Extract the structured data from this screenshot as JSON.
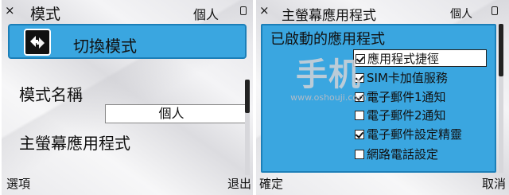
{
  "left": {
    "title": "模式",
    "profile": "個人",
    "close_glyph": "×",
    "switch_label": "切換模式",
    "mode_name_label": "模式名稱",
    "mode_name_value": "個人",
    "home_screen_label": "主螢幕應用程式",
    "softkey_left": "選項",
    "softkey_right": "退出"
  },
  "right": {
    "title": "主螢幕應用程式",
    "profile": "個人",
    "close_glyph": "×",
    "panel_title": "已啟動的應用程式",
    "options": [
      {
        "label": "應用程式捷徑",
        "checked": true,
        "selected": true
      },
      {
        "label": "SIM卡加值服務",
        "checked": true,
        "selected": false
      },
      {
        "label": "電子郵件1通知",
        "checked": true,
        "selected": false
      },
      {
        "label": "電子郵件2通知",
        "checked": false,
        "selected": false
      },
      {
        "label": "電子郵件設定精靈",
        "checked": true,
        "selected": false
      },
      {
        "label": "網路電話設定",
        "checked": false,
        "selected": false
      }
    ],
    "softkey_left": "確定",
    "softkey_right": "取消"
  },
  "watermark": {
    "logo": "手机",
    "url": "www.oshouji.com"
  },
  "colors": {
    "highlight": "#3aa6e0",
    "highlight_border": "#1c7fb8",
    "text": "#111111"
  },
  "icons": {
    "close": "close-icon",
    "battery": "battery-icon",
    "switch": "switch-arrows-icon",
    "checkbox": "checkbox-icon"
  }
}
